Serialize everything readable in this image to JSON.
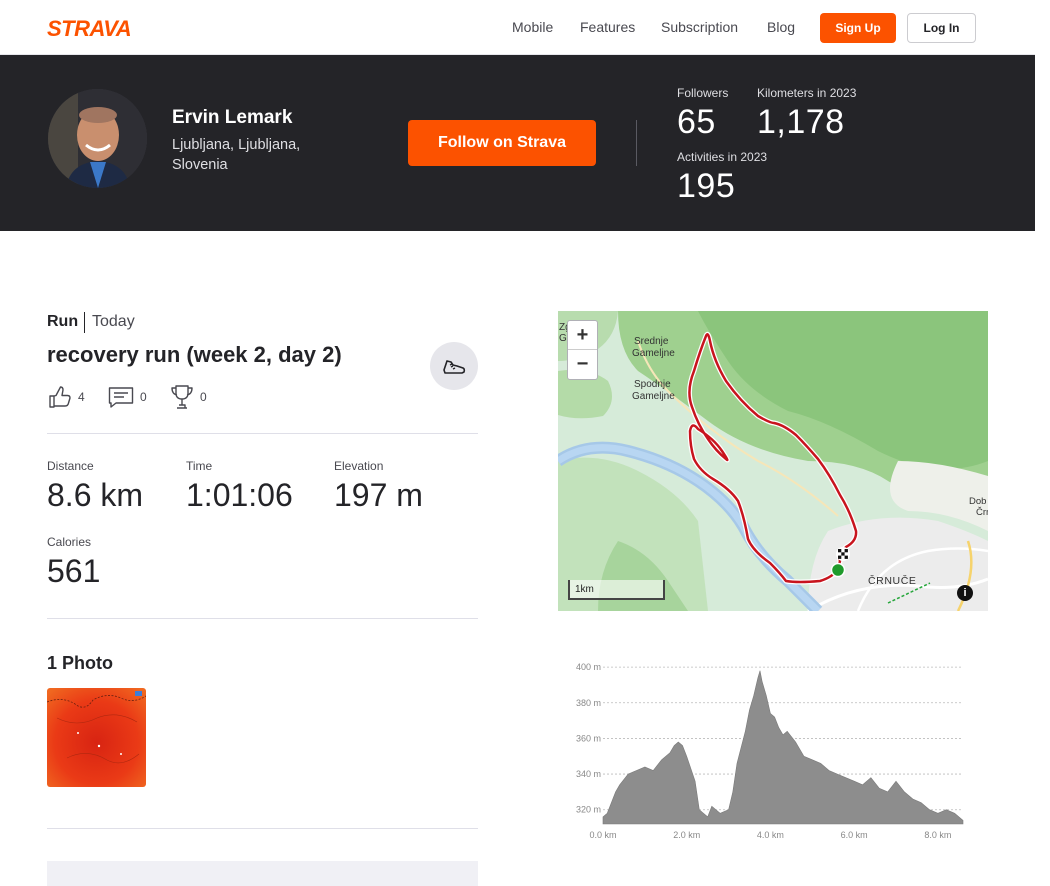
{
  "brand": {
    "logo_text": "STRAVA",
    "accent": "#fc5200",
    "dark": "#242428"
  },
  "nav": {
    "links": [
      "Mobile",
      "Features",
      "Subscription",
      "Blog"
    ],
    "signup": "Sign Up",
    "login": "Log In"
  },
  "athlete": {
    "name": "Ervin Lemark",
    "location": "Ljubljana, Ljubljana, Slovenia",
    "follow_label": "Follow on Strava",
    "stats": {
      "followers_label": "Followers",
      "followers_value": "65",
      "km_label": "Kilometers in 2023",
      "km_value": "1,178",
      "activities_label": "Activities in 2023",
      "activities_value": "195"
    }
  },
  "activity": {
    "type": "Run",
    "date": "Today",
    "title": "recovery run (week 2, day 2)",
    "kudos": "4",
    "comments": "0",
    "achievements": "0",
    "metrics": {
      "distance_label": "Distance",
      "distance_value": "8.6 km",
      "time_label": "Time",
      "time_value": "1:01:06",
      "elevation_label": "Elevation",
      "elevation_value": "197 m",
      "calories_label": "Calories",
      "calories_value": "561"
    },
    "photos_title": "1 Photo"
  },
  "map": {
    "labels": {
      "srednje": "Srednje",
      "gameljne1": "Gameljne",
      "spodnje": "Spodnje",
      "gameljne2": "Gameljne",
      "crnuce": "ČRNUČE",
      "zg": "Zg",
      "ga": "Ga",
      "dob": "Dob",
      "crn": "Črn"
    },
    "scale": "1km",
    "zoom_in": "+",
    "zoom_out": "−",
    "info": "i"
  },
  "elevation_chart": {
    "type": "area",
    "y_ticks": [
      "400 m",
      "380 m",
      "360 m",
      "340 m",
      "320 m"
    ],
    "x_ticks": [
      "0.0 km",
      "2.0 km",
      "4.0 km",
      "6.0 km",
      "8.0 km"
    ],
    "ylim": [
      312,
      404
    ],
    "xlim": [
      0,
      8.6
    ]
  },
  "chart_data": {
    "type": "area",
    "title": "",
    "xlabel": "",
    "ylabel": "",
    "x_unit": "km",
    "y_unit": "m",
    "xlim": [
      0,
      8.6
    ],
    "ylim": [
      312,
      404
    ],
    "x": [
      0.0,
      0.1,
      0.2,
      0.3,
      0.4,
      0.6,
      0.8,
      1.0,
      1.2,
      1.4,
      1.6,
      1.7,
      1.8,
      1.9,
      2.0,
      2.2,
      2.3,
      2.4,
      2.5,
      2.6,
      2.8,
      3.0,
      3.1,
      3.2,
      3.4,
      3.5,
      3.6,
      3.7,
      3.75,
      3.8,
      3.9,
      4.0,
      4.1,
      4.2,
      4.3,
      4.4,
      4.6,
      4.8,
      5.0,
      5.2,
      5.4,
      5.6,
      5.8,
      6.0,
      6.2,
      6.4,
      6.6,
      6.8,
      7.0,
      7.2,
      7.4,
      7.6,
      7.8,
      8.0,
      8.2,
      8.4,
      8.6
    ],
    "values": [
      316,
      318,
      324,
      330,
      334,
      340,
      342,
      344,
      342,
      348,
      352,
      356,
      358,
      356,
      350,
      336,
      320,
      318,
      316,
      322,
      318,
      320,
      330,
      346,
      364,
      376,
      384,
      394,
      398,
      392,
      384,
      374,
      372,
      366,
      362,
      364,
      358,
      350,
      348,
      346,
      342,
      340,
      338,
      336,
      334,
      338,
      332,
      330,
      336,
      330,
      326,
      324,
      320,
      318,
      320,
      318,
      314
    ]
  }
}
